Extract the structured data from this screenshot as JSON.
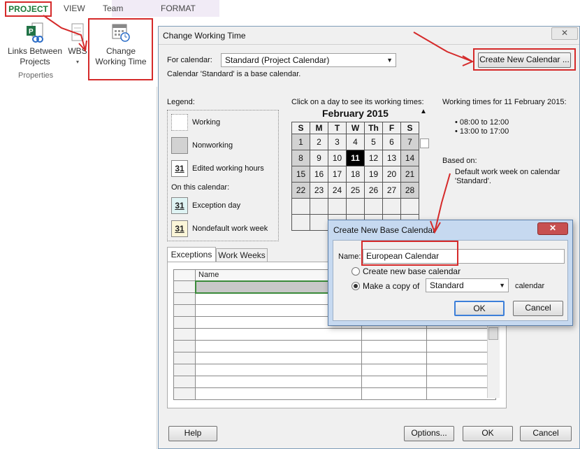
{
  "ribbon": {
    "tabs": [
      "PROJECT",
      "VIEW",
      "Team",
      "FORMAT"
    ],
    "buttons": {
      "links_between_projects": [
        "Links Between",
        "Projects"
      ],
      "wbs": "WBS",
      "change_working_time": [
        "Change",
        "Working Time"
      ]
    },
    "group_label": "Properties"
  },
  "dialog": {
    "title": "Change Working Time",
    "close_glyph": "✕",
    "for_calendar_label": "For calendar:",
    "for_calendar_value": "Standard (Project Calendar)",
    "create_new_calendar_button": "Create New Calendar ...",
    "base_calendar_note": "Calendar 'Standard' is a base calendar.",
    "legend": {
      "title": "Legend:",
      "working": "Working",
      "nonworking": "Nonworking",
      "edited_hours": "Edited working hours",
      "on_this_calendar": "On this calendar:",
      "exception_day": "Exception day",
      "nondefault_week": "Nondefault work week",
      "sample_day": "31"
    },
    "calendar_prompt": "Click on a day to see its working times:",
    "month_label": "February 2015",
    "weekdays": [
      "S",
      "M",
      "T",
      "W",
      "Th",
      "F",
      "S"
    ],
    "weeks": [
      [
        "1",
        "2",
        "3",
        "4",
        "5",
        "6",
        "7"
      ],
      [
        "8",
        "9",
        "10",
        "11",
        "12",
        "13",
        "14"
      ],
      [
        "15",
        "16",
        "17",
        "18",
        "19",
        "20",
        "21"
      ],
      [
        "22",
        "23",
        "24",
        "25",
        "26",
        "27",
        "28"
      ],
      [
        "",
        "",
        "",
        "",
        "",
        "",
        ""
      ],
      [
        "",
        "",
        "",
        "",
        "",
        "",
        ""
      ]
    ],
    "selected_day": "11",
    "working_times_title": "Working times for 11 February 2015:",
    "working_times": [
      "• 08:00 to 12:00",
      "• 13:00 to 17:00"
    ],
    "based_on_label": "Based on:",
    "based_on_text": [
      "Default work week on calendar",
      "'Standard'."
    ],
    "tabs": [
      "Exceptions",
      "Work Weeks"
    ],
    "grid_header_name": "Name",
    "buttons": {
      "help": "Help",
      "options": "Options...",
      "ok": "OK",
      "cancel": "Cancel"
    }
  },
  "new_calendar_dialog": {
    "title": "Create New Base Calendar",
    "close_glyph": "✕",
    "name_label": "Name:",
    "name_value": "European Calendar",
    "option_new": "Create new base calendar",
    "option_copy": "Make a copy of",
    "copy_source": "Standard",
    "calendar_suffix": "calendar",
    "ok": "OK",
    "cancel": "Cancel"
  },
  "colors": {
    "annotation_red": "#d52a2a",
    "project_tab_green": "#1d7b3a",
    "nonworking_gray": "#d2d2d2",
    "dialog_frame_blue": "#c6d9f0"
  }
}
